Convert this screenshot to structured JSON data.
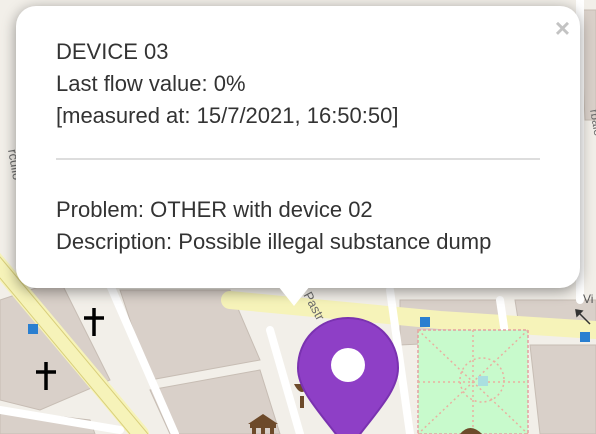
{
  "popup": {
    "device": "DEVICE 03",
    "flow": "Last flow value: 0%",
    "measured": "[measured at: 15/7/2021, 16:50:50]",
    "problem": "Problem: OTHER with device 02",
    "description": "Description: Possible illegal substance dump",
    "close_glyph": "×"
  },
  "map": {
    "street_label": "Vi",
    "marker_color": "#8e3fc6",
    "icons": [
      "church-cross-icon",
      "church-cross-icon",
      "poi-square-icon",
      "museum-icon",
      "fountain-icon"
    ]
  }
}
